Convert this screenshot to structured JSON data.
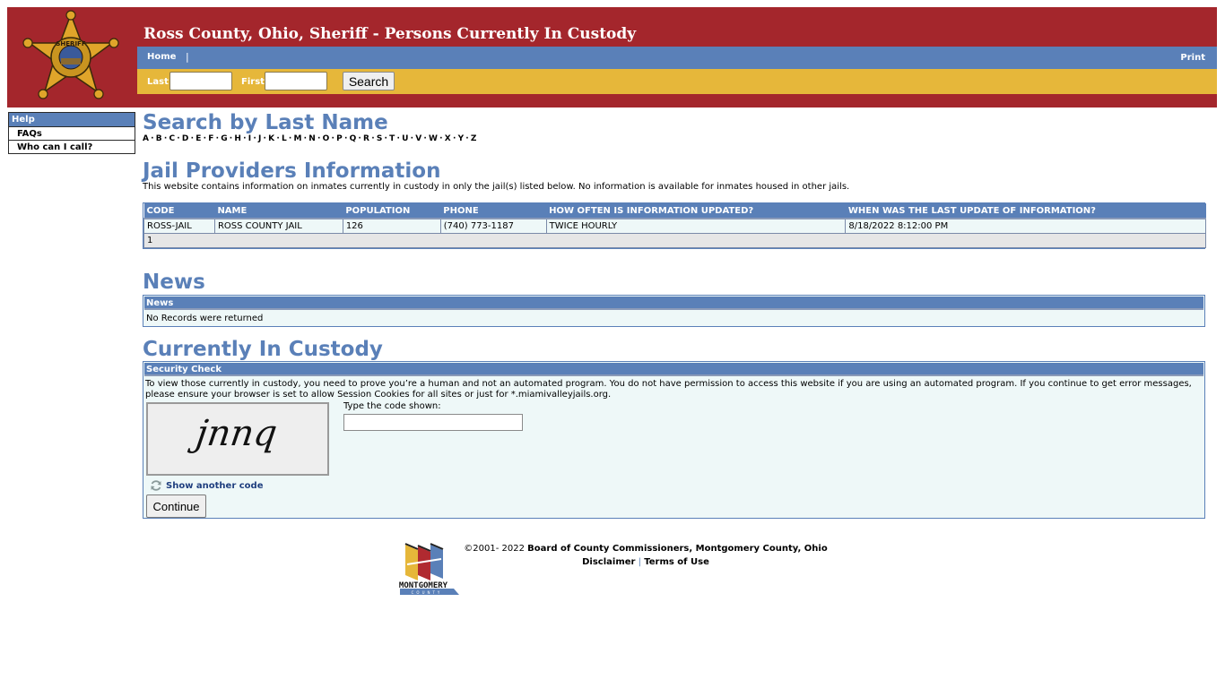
{
  "header": {
    "title": "Ross County, Ohio, Sheriff - Persons Currently In Custody",
    "logo_icon": "sheriff-star-badge",
    "nav": {
      "home": "Home",
      "separator": "|",
      "print": "Print"
    },
    "search": {
      "last_label": "Last",
      "last_value": "",
      "first_label": "First",
      "first_value": "",
      "button": "Search"
    }
  },
  "sidebar": {
    "heading": "Help",
    "items": [
      {
        "label": "FAQs"
      },
      {
        "label": "Who can I call?"
      }
    ]
  },
  "search_by_last_name": {
    "title": "Search by Last Name",
    "letters": [
      "A",
      "B",
      "C",
      "D",
      "E",
      "F",
      "G",
      "H",
      "I",
      "J",
      "K",
      "L",
      "M",
      "N",
      "O",
      "P",
      "Q",
      "R",
      "S",
      "T",
      "U",
      "V",
      "W",
      "X",
      "Y",
      "Z"
    ],
    "separator": "·"
  },
  "jail_providers": {
    "title": "Jail Providers Information",
    "description": "This website contains information on inmates currently in custody in only the jail(s) listed below. No information is available for inmates housed in other jails.",
    "columns": [
      "CODE",
      "NAME",
      "POPULATION",
      "PHONE",
      "HOW OFTEN IS INFORMATION UPDATED?",
      "WHEN WAS THE LAST UPDATE OF INFORMATION?"
    ],
    "rows": [
      [
        "ROSS-JAIL",
        "ROSS COUNTY JAIL",
        "126",
        "(740) 773-1187",
        "TWICE HOURLY",
        "8/18/2022 8:12:00 PM"
      ]
    ],
    "pager": "1"
  },
  "news": {
    "title": "News",
    "panel_heading": "News",
    "message": "No Records were returned"
  },
  "custody": {
    "title": "Currently In Custody",
    "panel_heading": "Security Check",
    "instructions": "To view those currently in custody, you need to prove you’re a human and not an automated program. You do not have permission to access this website if you are using an automated program. If you continue to get error messages, please ensure your browser is set to allow Session Cookies for all sites or just for *.miamivalleyjails.org.",
    "captcha_text": "jnnq",
    "code_label": "Type the code shown:",
    "code_value": "",
    "refresh_label": "Show another code",
    "continue_label": "Continue"
  },
  "footer": {
    "copyright": "©2001- 2022 ",
    "organization": "Board of County Commissioners, Montgomery County, Ohio",
    "disclaimer": "Disclaimer",
    "separator": "|",
    "terms": "Terms of Use",
    "logo_text": "MONTGOMERY",
    "logo_subtext": "COUNTY"
  },
  "colors": {
    "header_red": "#a4262c",
    "nav_blue": "#5a80b8",
    "search_gold": "#e6b73a",
    "panel_bg": "#eef8f8"
  }
}
